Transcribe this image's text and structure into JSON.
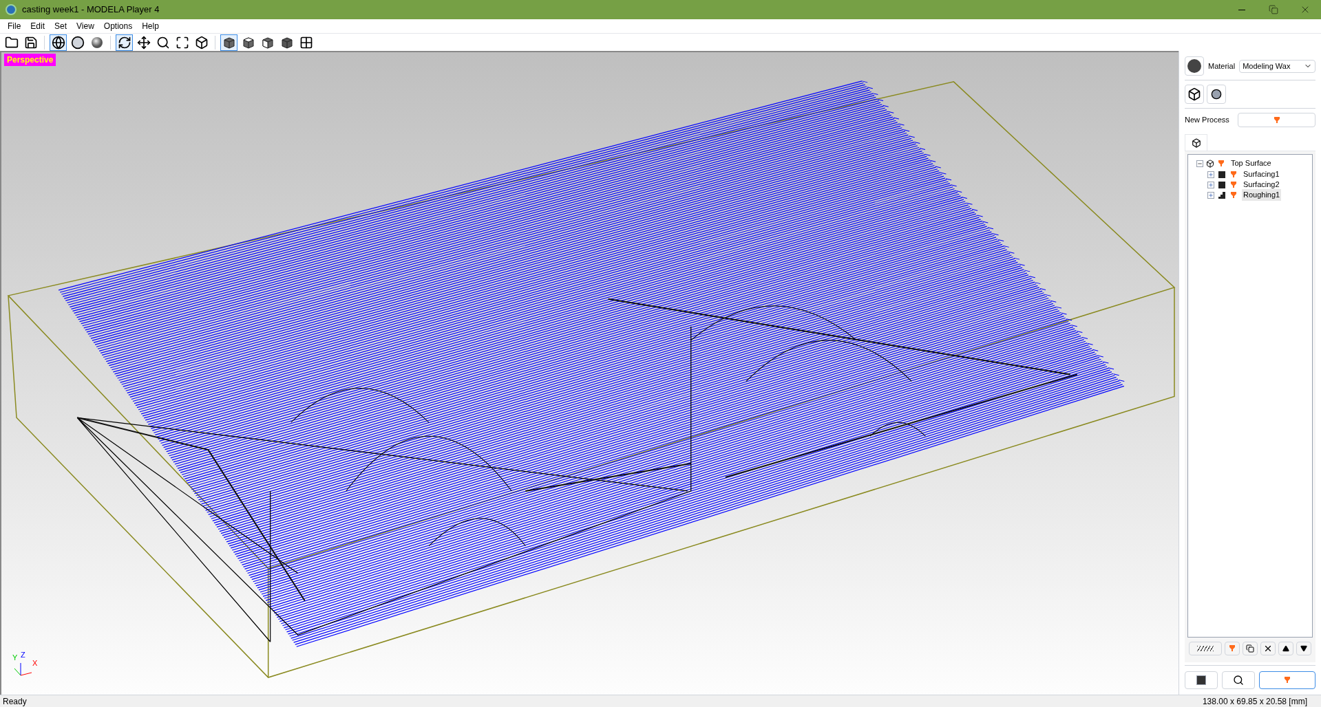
{
  "window": {
    "title": "casting week1 - MODELA Player 4"
  },
  "menu": [
    "File",
    "Edit",
    "Set",
    "View",
    "Options",
    "Help"
  ],
  "toolbar": [
    {
      "kind": "open",
      "selected": false
    },
    {
      "kind": "save",
      "selected": false
    },
    {
      "kind": "sep"
    },
    {
      "kind": "wireframe",
      "selected": true
    },
    {
      "kind": "surface",
      "selected": false
    },
    {
      "kind": "shaded",
      "selected": false
    },
    {
      "kind": "sep"
    },
    {
      "kind": "rotate",
      "selected": true
    },
    {
      "kind": "pan",
      "selected": false
    },
    {
      "kind": "zoom",
      "selected": false
    },
    {
      "kind": "fit",
      "selected": false
    },
    {
      "kind": "fit-model",
      "selected": false
    },
    {
      "kind": "sep"
    },
    {
      "kind": "view-iso",
      "selected": true
    },
    {
      "kind": "view-top",
      "selected": false
    },
    {
      "kind": "view-front",
      "selected": false
    },
    {
      "kind": "view-side",
      "selected": false
    },
    {
      "kind": "view-multi",
      "selected": false
    }
  ],
  "viewport": {
    "label": "Perspective",
    "axes": [
      "Y",
      "Z",
      "X"
    ]
  },
  "panel": {
    "material_label": "Material",
    "material": "Modeling Wax",
    "new_process_label": "New Process",
    "tree": {
      "label": "Top Surface",
      "expanded": true,
      "children": [
        {
          "label": "Surfacing1",
          "kind": "surfacing",
          "selected": false
        },
        {
          "label": "Surfacing2",
          "kind": "surfacing",
          "selected": false
        },
        {
          "label": "Roughing1",
          "kind": "roughing",
          "selected": true
        }
      ]
    }
  },
  "status_bar": {
    "left": "Ready",
    "right": "138.00 x 69.85 x 20.58 [mm]"
  }
}
